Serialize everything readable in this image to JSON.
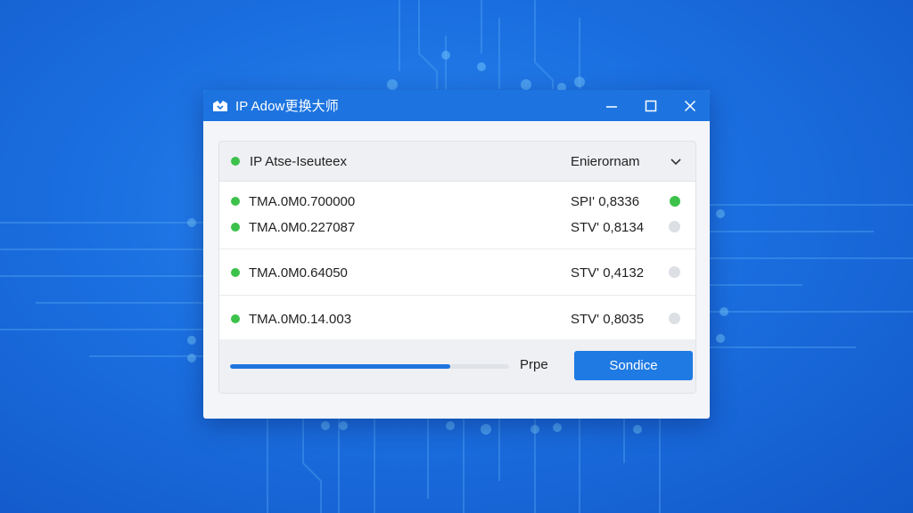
{
  "window": {
    "title": "IP Adow更换大师"
  },
  "header": {
    "label": "IP Atse-Iseuteex",
    "environment": "Enierornam"
  },
  "rows": [
    {
      "ip": "TMA.0M0.700000",
      "value": "SPI' 0,8336",
      "status": "active"
    },
    {
      "ip": "TMA.0M0.227087",
      "value": "STV' 0,8134",
      "status": "inactive"
    },
    {
      "ip": "TMA.0M0.64050",
      "value": "STV' 0,4132",
      "status": "inactive"
    },
    {
      "ip": "TMA.0M0.14.003",
      "value": "STV' 0,8035",
      "status": "inactive"
    }
  ],
  "footer": {
    "progress_label": "Prpe",
    "progress": 0.79,
    "action_label": "Sondice"
  },
  "colors": {
    "accent": "#1f7ae3",
    "titlebar": "#1d74e0",
    "status_active": "#3cc24a",
    "status_inactive": "#dcdfe4"
  },
  "icons": {
    "app": "app-logo-icon",
    "minimize": "minimize-icon",
    "maximize": "maximize-icon",
    "close": "close-icon",
    "dropdown": "chevron-down-icon"
  }
}
